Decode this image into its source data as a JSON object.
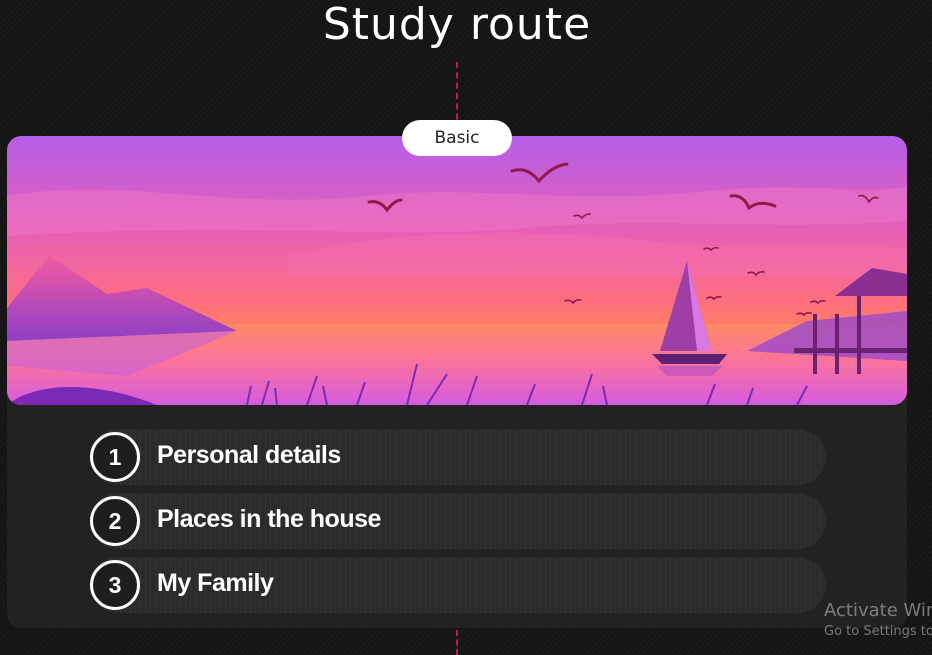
{
  "header": {
    "title": "Study route"
  },
  "route": {
    "level": "Basic"
  },
  "lessons": [
    {
      "number": "1",
      "title": "Personal details"
    },
    {
      "number": "2",
      "title": "Places in the house"
    },
    {
      "number": "3",
      "title": "My Family"
    }
  ],
  "watermark": {
    "title": "Activate Windows",
    "subtitle": "Go to Settings to activate Windows."
  },
  "colors": {
    "background": "#141414",
    "card": "#222222",
    "route_line": "#c2185b",
    "sky_top": "#b65ee8",
    "sky_mid": "#f26aa4",
    "sun_horizon": "#ff7f50"
  }
}
